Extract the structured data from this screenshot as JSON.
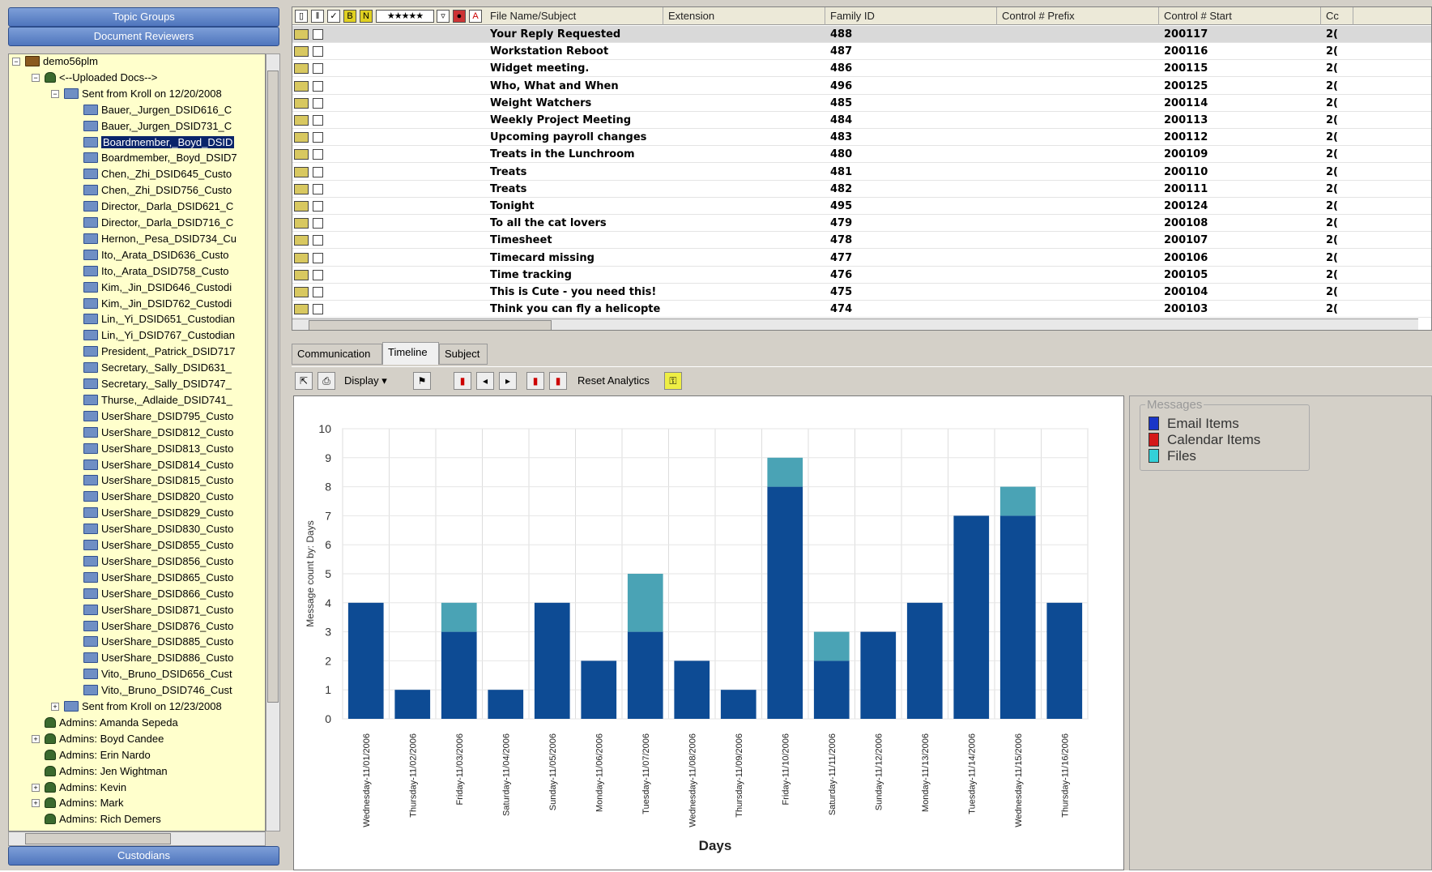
{
  "sidebar": {
    "topic_groups": "Topic Groups",
    "document_reviewers": "Document Reviewers",
    "custodians": "Custodians",
    "tree": [
      {
        "label": "demo56plm",
        "level": 0,
        "icon": "brief",
        "exp": "⊟"
      },
      {
        "label": "<--Uploaded Docs-->",
        "level": 1,
        "icon": "user",
        "exp": "⊟"
      },
      {
        "label": "Sent from Kroll on 12/20/2008",
        "level": 2,
        "icon": "folder",
        "exp": "⊟"
      },
      {
        "label": "Bauer,_Jurgen_DSID616_C",
        "level": 3,
        "icon": "folder"
      },
      {
        "label": "Bauer,_Jurgen_DSID731_C",
        "level": 3,
        "icon": "folder"
      },
      {
        "label": "Boardmember,_Boyd_DSID",
        "level": 3,
        "icon": "folder",
        "selected": true
      },
      {
        "label": "Boardmember,_Boyd_DSID7",
        "level": 3,
        "icon": "folder"
      },
      {
        "label": "Chen,_Zhi_DSID645_Custo",
        "level": 3,
        "icon": "folder"
      },
      {
        "label": "Chen,_Zhi_DSID756_Custo",
        "level": 3,
        "icon": "folder"
      },
      {
        "label": "Director,_Darla_DSID621_C",
        "level": 3,
        "icon": "folder"
      },
      {
        "label": "Director,_Darla_DSID716_C",
        "level": 3,
        "icon": "folder"
      },
      {
        "label": "Hernon,_Pesa_DSID734_Cu",
        "level": 3,
        "icon": "folder"
      },
      {
        "label": "Ito,_Arata_DSID636_Custo",
        "level": 3,
        "icon": "folder"
      },
      {
        "label": "Ito,_Arata_DSID758_Custo",
        "level": 3,
        "icon": "folder"
      },
      {
        "label": "Kim,_Jin_DSID646_Custodi",
        "level": 3,
        "icon": "folder"
      },
      {
        "label": "Kim,_Jin_DSID762_Custodi",
        "level": 3,
        "icon": "folder"
      },
      {
        "label": "Lin,_Yi_DSID651_Custodian",
        "level": 3,
        "icon": "folder"
      },
      {
        "label": "Lin,_Yi_DSID767_Custodian",
        "level": 3,
        "icon": "folder"
      },
      {
        "label": "President,_Patrick_DSID717",
        "level": 3,
        "icon": "folder"
      },
      {
        "label": "Secretary,_Sally_DSID631_",
        "level": 3,
        "icon": "folder"
      },
      {
        "label": "Secretary,_Sally_DSID747_",
        "level": 3,
        "icon": "folder"
      },
      {
        "label": "Thurse,_Adlaide_DSID741_",
        "level": 3,
        "icon": "folder"
      },
      {
        "label": "UserShare_DSID795_Custo",
        "level": 3,
        "icon": "folder"
      },
      {
        "label": "UserShare_DSID812_Custo",
        "level": 3,
        "icon": "folder"
      },
      {
        "label": "UserShare_DSID813_Custo",
        "level": 3,
        "icon": "folder"
      },
      {
        "label": "UserShare_DSID814_Custo",
        "level": 3,
        "icon": "folder"
      },
      {
        "label": "UserShare_DSID815_Custo",
        "level": 3,
        "icon": "folder"
      },
      {
        "label": "UserShare_DSID820_Custo",
        "level": 3,
        "icon": "folder"
      },
      {
        "label": "UserShare_DSID829_Custo",
        "level": 3,
        "icon": "folder"
      },
      {
        "label": "UserShare_DSID830_Custo",
        "level": 3,
        "icon": "folder"
      },
      {
        "label": "UserShare_DSID855_Custo",
        "level": 3,
        "icon": "folder"
      },
      {
        "label": "UserShare_DSID856_Custo",
        "level": 3,
        "icon": "folder"
      },
      {
        "label": "UserShare_DSID865_Custo",
        "level": 3,
        "icon": "folder"
      },
      {
        "label": "UserShare_DSID866_Custo",
        "level": 3,
        "icon": "folder"
      },
      {
        "label": "UserShare_DSID871_Custo",
        "level": 3,
        "icon": "folder"
      },
      {
        "label": "UserShare_DSID876_Custo",
        "level": 3,
        "icon": "folder"
      },
      {
        "label": "UserShare_DSID885_Custo",
        "level": 3,
        "icon": "folder"
      },
      {
        "label": "UserShare_DSID886_Custo",
        "level": 3,
        "icon": "folder"
      },
      {
        "label": "Vito,_Bruno_DSID656_Cust",
        "level": 3,
        "icon": "folder"
      },
      {
        "label": "Vito,_Bruno_DSID746_Cust",
        "level": 3,
        "icon": "folder"
      },
      {
        "label": "Sent from Kroll on 12/23/2008",
        "level": 2,
        "icon": "folder",
        "exp": "⊞"
      },
      {
        "label": "Admins: Amanda Sepeda",
        "level": 1,
        "icon": "user"
      },
      {
        "label": "Admins: Boyd Candee",
        "level": 1,
        "icon": "user",
        "exp": "⊞"
      },
      {
        "label": "Admins: Erin Nardo",
        "level": 1,
        "icon": "user"
      },
      {
        "label": "Admins: Jen Wightman",
        "level": 1,
        "icon": "user"
      },
      {
        "label": "Admins: Kevin",
        "level": 1,
        "icon": "user",
        "exp": "⊞"
      },
      {
        "label": "Admins: Mark",
        "level": 1,
        "icon": "user",
        "exp": "⊞"
      },
      {
        "label": "Admins: Rich Demers",
        "level": 1,
        "icon": "user"
      }
    ]
  },
  "grid": {
    "headers": {
      "subject": "File Name/Subject",
      "extension": "Extension",
      "family": "Family ID",
      "prefix": "Control # Prefix",
      "start": "Control # Start",
      "cc": "Cc"
    },
    "rating_icon": "★★★★★",
    "rows": [
      {
        "subject": "Your Reply Requested",
        "family": "488",
        "start": "200117",
        "cc": "2("
      },
      {
        "subject": "Workstation Reboot",
        "family": "487",
        "start": "200116",
        "cc": "2("
      },
      {
        "subject": "Widget meeting.",
        "family": "486",
        "start": "200115",
        "cc": "2("
      },
      {
        "subject": "Who, What and When",
        "family": "496",
        "start": "200125",
        "cc": "2("
      },
      {
        "subject": "Weight Watchers",
        "family": "485",
        "start": "200114",
        "cc": "2("
      },
      {
        "subject": "Weekly Project Meeting",
        "family": "484",
        "start": "200113",
        "cc": "2("
      },
      {
        "subject": "Upcoming payroll changes",
        "family": "483",
        "start": "200112",
        "cc": "2("
      },
      {
        "subject": "Treats in the Lunchroom",
        "family": "480",
        "start": "200109",
        "cc": "2("
      },
      {
        "subject": "Treats",
        "family": "481",
        "start": "200110",
        "cc": "2("
      },
      {
        "subject": "Treats",
        "family": "482",
        "start": "200111",
        "cc": "2("
      },
      {
        "subject": "Tonight",
        "family": "495",
        "start": "200124",
        "cc": "2("
      },
      {
        "subject": "To all the cat lovers",
        "family": "479",
        "start": "200108",
        "cc": "2("
      },
      {
        "subject": "Timesheet",
        "family": "478",
        "start": "200107",
        "cc": "2("
      },
      {
        "subject": "Timecard missing",
        "family": "477",
        "start": "200106",
        "cc": "2("
      },
      {
        "subject": "Time tracking",
        "family": "476",
        "start": "200105",
        "cc": "2("
      },
      {
        "subject": "This is Cute - you need this!",
        "family": "475",
        "start": "200104",
        "cc": "2("
      },
      {
        "subject": "Think you can fly a helicopter?",
        "family": "474",
        "start": "200103",
        "cc": "2("
      }
    ]
  },
  "tabs": [
    "Communication",
    "Timeline",
    "Subject"
  ],
  "toolbar": {
    "display": "Display",
    "reset": "Reset Analytics"
  },
  "legend": {
    "title": "Messages",
    "items": [
      {
        "label": "Email Items",
        "color": "#1a35c8"
      },
      {
        "label": "Calendar Items",
        "color": "#d41818"
      },
      {
        "label": "Files",
        "color": "#33d0d8"
      }
    ]
  },
  "chart_data": {
    "type": "bar",
    "stacked": true,
    "xlabel": "Days",
    "ylabel": "Message count by: Days",
    "ylim": [
      0,
      10
    ],
    "yticks": [
      0,
      1,
      2,
      3,
      4,
      5,
      6,
      7,
      8,
      9,
      10
    ],
    "categories": [
      "Wednesday - 11/01/2006",
      "Thursday - 11/02/2006",
      "Friday - 11/03/2006",
      "Saturday - 11/04/2006",
      "Sunday - 11/05/2006",
      "Monday - 11/06/2006",
      "Tuesday - 11/07/2006",
      "Wednesday - 11/08/2006",
      "Thursday - 11/09/2006",
      "Friday - 11/10/2006",
      "Saturday - 11/11/2006",
      "Sunday - 11/12/2006",
      "Monday - 11/13/2006",
      "Tuesday - 11/14/2006",
      "Wednesday - 11/15/2006",
      "Thursday - 11/16/2006"
    ],
    "series": [
      {
        "name": "Email Items",
        "color": "#0d4b94",
        "values": [
          4,
          1,
          3,
          1,
          4,
          2,
          3,
          2,
          1,
          8,
          2,
          3,
          4,
          7,
          7,
          4
        ]
      },
      {
        "name": "Files",
        "color": "#4aa3b5",
        "values": [
          0,
          0,
          1,
          0,
          0,
          0,
          2,
          0,
          0,
          1,
          1,
          0,
          0,
          0,
          1,
          0
        ]
      }
    ]
  }
}
